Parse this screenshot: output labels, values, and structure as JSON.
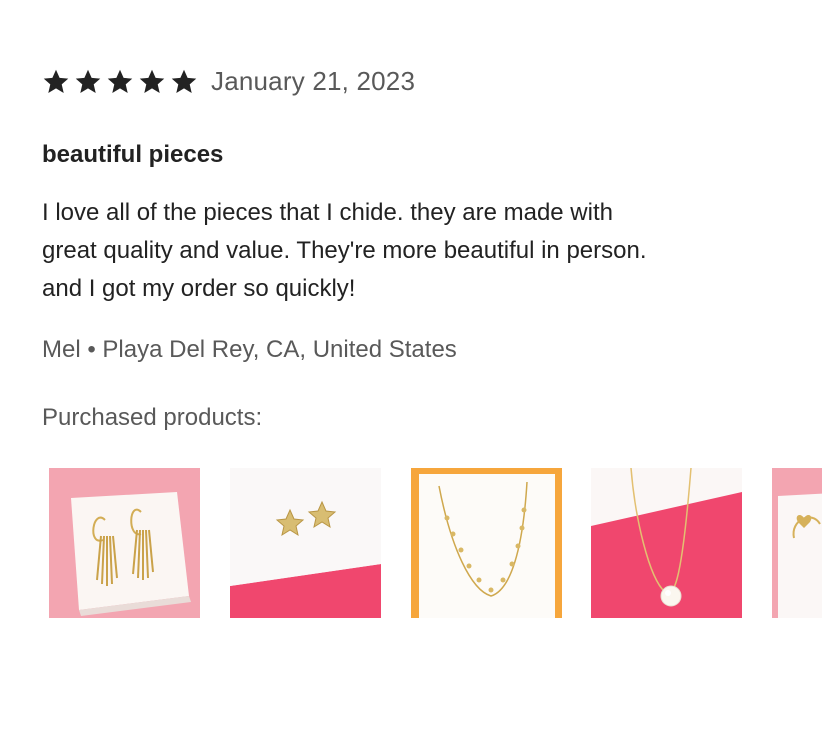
{
  "review": {
    "rating": 5,
    "rating_max": 5,
    "date": "January 21, 2023",
    "title": "beautiful pieces",
    "body_lines": [
      "I love all of the pieces that I chide. they are made with",
      "great quality and value. They're more beautiful in person.",
      "and I got my order so quickly!"
    ],
    "reviewer": "Mel • Playa Del Rey, CA, United States"
  },
  "purchased_label": "Purchased products:",
  "products": [
    {
      "icon": "fringe-hoop-earrings-image"
    },
    {
      "icon": "star-stud-earrings-image"
    },
    {
      "icon": "charm-necklace-image"
    },
    {
      "icon": "pearl-pendant-necklace-image"
    },
    {
      "icon": "heart-bracelet-image"
    }
  ],
  "colors": {
    "star": "#222222",
    "muted_text": "#595959",
    "pink_bg": "#f2a3ae",
    "hot_pink": "#f0476e"
  }
}
